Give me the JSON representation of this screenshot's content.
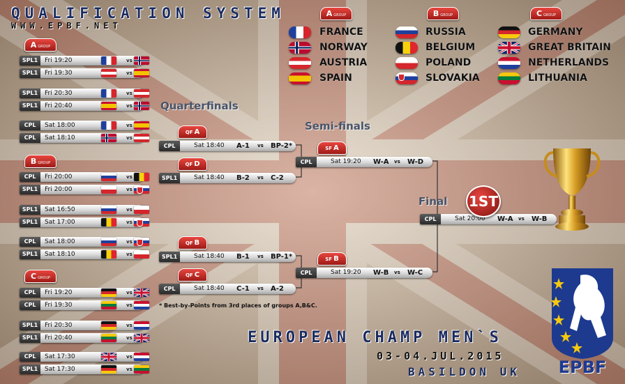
{
  "header": {
    "title": "QUALIFICATION SYSTEM",
    "url": "WWW.EPBF.NET"
  },
  "legend": {
    "badge_sub": "GROUP",
    "groups": [
      {
        "letter": "A",
        "teams": [
          "FRANCE",
          "NORWAY",
          "AUSTRIA",
          "SPAIN"
        ]
      },
      {
        "letter": "B",
        "teams": [
          "RUSSIA",
          "BELGIUM",
          "POLAND",
          "SLOVAKIA"
        ]
      },
      {
        "letter": "C",
        "teams": [
          "GERMANY",
          "GREAT BRITAIN",
          "NETHERLANDS",
          "LITHUANIA"
        ]
      }
    ]
  },
  "group_matches": [
    {
      "tv": "SPL1",
      "time": "Fri 19:20",
      "home": "france",
      "away": "norway"
    },
    {
      "tv": "SPL1",
      "time": "Fri 19:30",
      "home": "austria",
      "away": "spain"
    },
    {
      "tv": "SPL1",
      "time": "Fri 20:30",
      "home": "france",
      "away": "austria"
    },
    {
      "tv": "SPL1",
      "time": "Fri 20:40",
      "home": "spain",
      "away": "norway"
    },
    {
      "tv": "CPL",
      "time": "Sat 18:00",
      "home": "france",
      "away": "spain"
    },
    {
      "tv": "CPL",
      "time": "Sat 18:10",
      "home": "norway",
      "away": "austria"
    },
    {
      "tv": "CPL",
      "time": "Fri 20:00",
      "home": "russia",
      "away": "belgium"
    },
    {
      "tv": "SPL1",
      "time": "Fri 20:00",
      "home": "poland",
      "away": "slovakia"
    },
    {
      "tv": "SPL1",
      "time": "Sat 16:50",
      "home": "russia",
      "away": "poland"
    },
    {
      "tv": "SPL1",
      "time": "Sat 17:00",
      "home": "belgium",
      "away": "slovakia"
    },
    {
      "tv": "CPL",
      "time": "Sat 18:00",
      "home": "russia",
      "away": "slovakia"
    },
    {
      "tv": "SPL1",
      "time": "Sat 18:10",
      "home": "belgium",
      "away": "poland"
    },
    {
      "tv": "CPL",
      "time": "Fri 19:20",
      "home": "germany",
      "away": "greatbritain"
    },
    {
      "tv": "CPL",
      "time": "Fri 19:30",
      "home": "lithuania",
      "away": "netherlands"
    },
    {
      "tv": "SPL1",
      "time": "Fri 20:30",
      "home": "germany",
      "away": "netherlands"
    },
    {
      "tv": "SPL1",
      "time": "Fri 20:40",
      "home": "lithuania",
      "away": "greatbritain"
    },
    {
      "tv": "CPL",
      "time": "Sat 17:30",
      "home": "greatbritain",
      "away": "netherlands"
    },
    {
      "tv": "SPL1",
      "time": "Sat 17:30",
      "home": "germany",
      "away": "lithuania"
    }
  ],
  "vs_label": "vs",
  "stages": {
    "quarterfinals": "Quarterfinals",
    "semifinals": "Semi-finals",
    "final": "Final"
  },
  "knockout": [
    {
      "badge_prefix": "QF",
      "badge_letter": "A",
      "tv": "CPL",
      "time": "Sat 18:40",
      "a": "A-1",
      "b": "BP-2*"
    },
    {
      "badge_prefix": "QF",
      "badge_letter": "D",
      "tv": "SPL1",
      "time": "Sat 18:40",
      "a": "B-2",
      "b": "C-2"
    },
    {
      "badge_prefix": "QF",
      "badge_letter": "B",
      "tv": "SPL1",
      "time": "Sat 18:40",
      "a": "B-1",
      "b": "BP-1*"
    },
    {
      "badge_prefix": "QF",
      "badge_letter": "C",
      "tv": "CPL",
      "time": "Sat 18:40",
      "a": "C-1",
      "b": "A-2"
    },
    {
      "badge_prefix": "SF",
      "badge_letter": "A",
      "tv": "CPL",
      "time": "Sat 19:20",
      "a": "W-A",
      "b": "W-D"
    },
    {
      "badge_prefix": "SF",
      "badge_letter": "B",
      "tv": "CPL",
      "time": "Sat 19:20",
      "a": "W-B",
      "b": "W-C"
    },
    {
      "badge_prefix": "",
      "badge_letter": "",
      "tv": "CPL",
      "time": "Sat 20:00",
      "a": "W-A",
      "b": "W-B"
    }
  ],
  "final_badge": "1ST",
  "note": "* Best-by-Points from 3rd places of groups A,B&C.",
  "footer": {
    "event": "EUROPEAN CHAMP MEN`S",
    "dates": "03-04.JUL.2015",
    "city": "BASILDON UK",
    "logo": "EPBF"
  }
}
